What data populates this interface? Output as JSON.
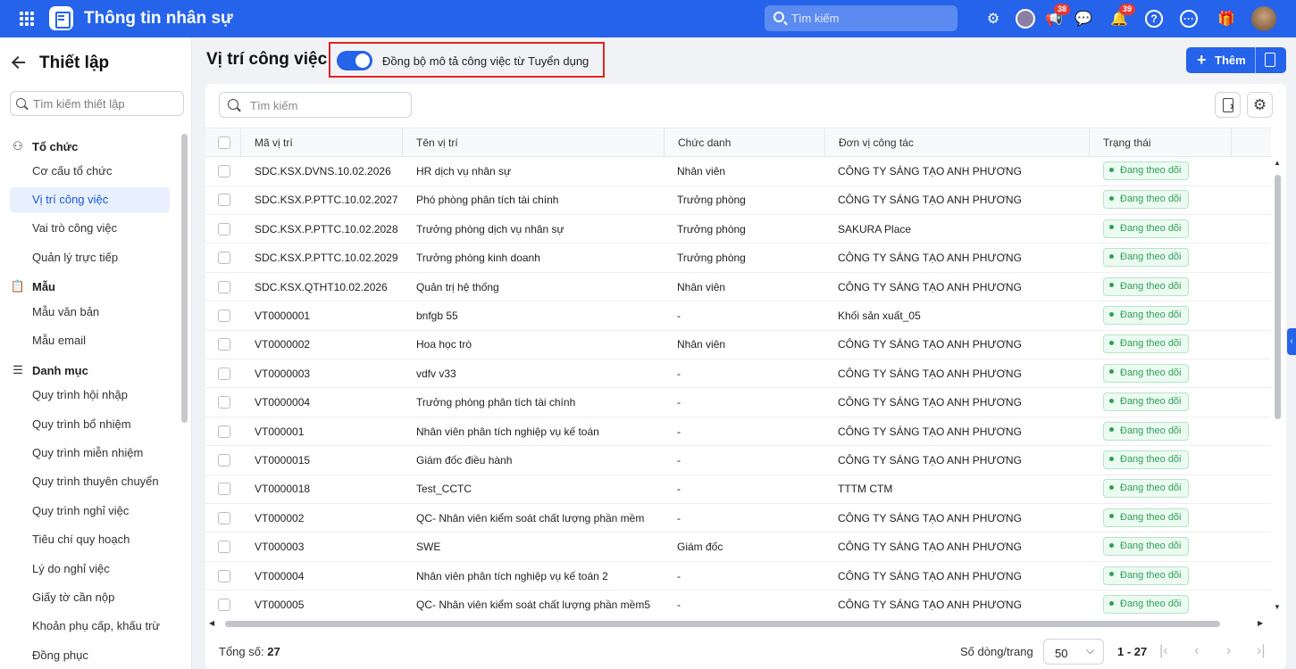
{
  "header": {
    "app_title": "Thông tin nhân sự",
    "search_placeholder": "Tìm kiếm",
    "megaphone_badge": "38",
    "bell_badge": "39",
    "help_glyph": "?",
    "more_glyph": "···",
    "brand_color": "#2563eb"
  },
  "sidebar": {
    "title": "Thiết lập",
    "search_placeholder": "Tìm kiếm thiết lập",
    "groups": [
      {
        "label": "Tổ chức",
        "icon": "org-chart-icon",
        "items": [
          "Cơ cấu tổ chức",
          "Vị trí công việc",
          "Vai trò công việc",
          "Quản lý trực tiếp"
        ]
      },
      {
        "label": "Mẫu",
        "icon": "clipboard-icon",
        "items": [
          "Mẫu văn bản",
          "Mẫu email"
        ]
      },
      {
        "label": "Danh mục",
        "icon": "list-icon",
        "items": [
          "Quy trình hội nhập",
          "Quy trình bổ nhiệm",
          "Quy trình miễn nhiệm",
          "Quy trình thuyên chuyển",
          "Quy trình nghỉ việc",
          "Tiêu chí quy hoạch",
          "Lý do nghỉ việc",
          "Giấy tờ cần nộp",
          "Khoản phụ cấp, khấu trừ",
          "Đồng phục"
        ]
      }
    ],
    "active_item": "Vị trí công việc"
  },
  "main": {
    "title": "Vị trí công việc",
    "sync_toggle": {
      "label": "Đồng bộ mô tả công việc từ Tuyển dụng",
      "on": true
    },
    "add_button_label": "Thêm",
    "table_search_placeholder": "Tìm kiếm",
    "columns": [
      "Mã vị trí",
      "Tên vị trí",
      "Chức danh",
      "Đơn vị công tác",
      "Trạng thái"
    ],
    "rows": [
      {
        "code": "SDC.KSX.DVNS.10.02.2026",
        "name": "HR dịch vụ nhân sự",
        "title": "Nhân viên",
        "unit": "CÔNG TY SÁNG TẠO ANH PHƯƠNG",
        "status": "Đang theo dõi"
      },
      {
        "code": "SDC.KSX.P.PTTC.10.02.2027",
        "name": "Phó phòng phân tích tài chính",
        "title": "Trưởng phòng",
        "unit": "CÔNG TY SÁNG TẠO ANH PHƯƠNG",
        "status": "Đang theo dõi"
      },
      {
        "code": "SDC.KSX.P.PTTC.10.02.2028",
        "name": "Trưởng phòng dịch vụ nhân sự",
        "title": "Trưởng phòng",
        "unit": "SAKURA Place",
        "status": "Đang theo dõi"
      },
      {
        "code": "SDC.KSX.P.PTTC.10.02.2029",
        "name": "Trưởng phòng kinh doanh",
        "title": "Trưởng phòng",
        "unit": "CÔNG TY SÁNG TẠO ANH PHƯƠNG",
        "status": "Đang theo dõi"
      },
      {
        "code": "SDC.KSX.QTHT10.02.2026",
        "name": "Quản trị hệ thống",
        "title": "Nhân viên",
        "unit": "CÔNG TY SÁNG TẠO ANH PHƯƠNG",
        "status": "Đang theo dõi"
      },
      {
        "code": "VT0000001",
        "name": "bnfgb 55",
        "title": "-",
        "unit": "Khối sản xuất_05",
        "status": "Đang theo dõi"
      },
      {
        "code": "VT0000002",
        "name": "Hoa học trò",
        "title": "Nhân viên",
        "unit": "CÔNG TY SÁNG TẠO ANH PHƯƠNG",
        "status": "Đang theo dõi"
      },
      {
        "code": "VT0000003",
        "name": "vdfv v33",
        "title": "-",
        "unit": "CÔNG TY SÁNG TẠO ANH PHƯƠNG",
        "status": "Đang theo dõi"
      },
      {
        "code": "VT0000004",
        "name": "Trưởng phòng phân tích tài chính",
        "title": "-",
        "unit": "CÔNG TY SÁNG TẠO ANH PHƯƠNG",
        "status": "Đang theo dõi"
      },
      {
        "code": "VT000001",
        "name": "Nhân viên phân tích nghiệp vụ kế toán",
        "title": "-",
        "unit": "CÔNG TY SÁNG TẠO ANH PHƯƠNG",
        "status": "Đang theo dõi"
      },
      {
        "code": "VT0000015",
        "name": "Giám đốc điều hành",
        "title": "-",
        "unit": "CÔNG TY SÁNG TẠO ANH PHƯƠNG",
        "status": "Đang theo dõi"
      },
      {
        "code": "VT0000018",
        "name": "Test_CCTC",
        "title": "-",
        "unit": "TTTM CTM",
        "status": "Đang theo dõi"
      },
      {
        "code": "VT000002",
        "name": "QC- Nhân viên kiểm soát chất lượng phần mềm",
        "title": "-",
        "unit": "CÔNG TY SÁNG TẠO ANH PHƯƠNG",
        "status": "Đang theo dõi"
      },
      {
        "code": "VT000003",
        "name": "SWE",
        "title": "Giám đốc",
        "unit": "CÔNG TY SÁNG TẠO ANH PHƯƠNG",
        "status": "Đang theo dõi"
      },
      {
        "code": "VT000004",
        "name": "Nhân viên phân tích nghiệp vụ kế toán 2",
        "title": "-",
        "unit": "CÔNG TY SÁNG TẠO ANH PHƯƠNG",
        "status": "Đang theo dõi"
      },
      {
        "code": "VT000005",
        "name": "QC- Nhân viên kiểm soát chất lượng phần mềm5",
        "title": "-",
        "unit": "CÔNG TY SÁNG TẠO ANH PHƯƠNG",
        "status": "Đang theo dõi"
      }
    ],
    "footer": {
      "total_label": "Tổng số:",
      "total_value": "27",
      "rows_per_page_label": "Số dòng/trang",
      "rows_per_page_value": "50",
      "range": "1 - 27"
    }
  }
}
